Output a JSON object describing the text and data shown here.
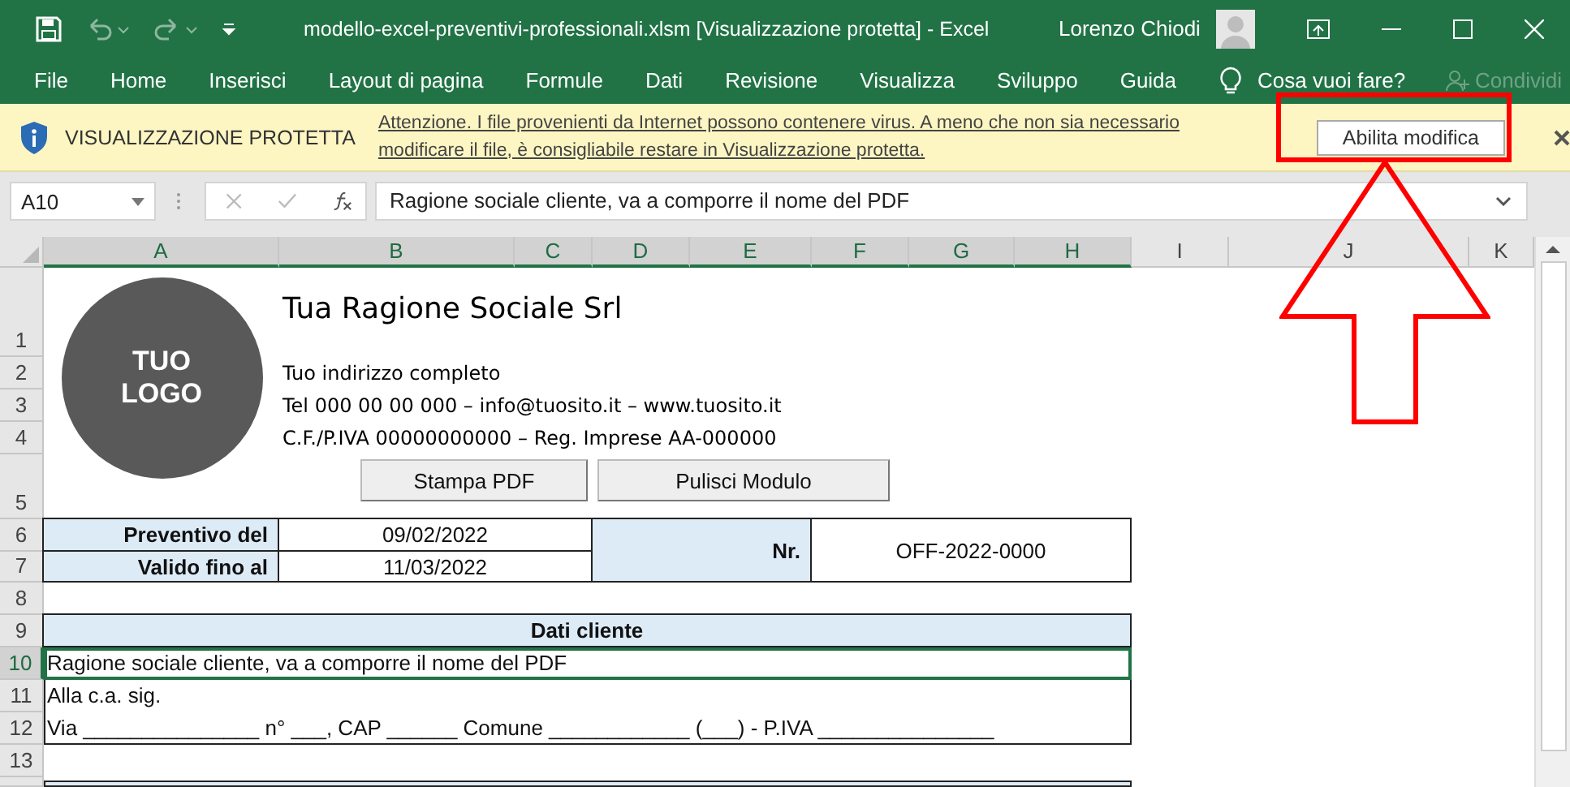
{
  "window": {
    "title": "modello-excel-preventivi-professionali.xlsm  [Visualizzazione protetta]  -  Excel",
    "user": "Lorenzo Chiodi"
  },
  "ribbon_tabs": [
    {
      "label": "File"
    },
    {
      "label": "Home"
    },
    {
      "label": "Inserisci"
    },
    {
      "label": "Layout di pagina"
    },
    {
      "label": "Formule"
    },
    {
      "label": "Dati"
    },
    {
      "label": "Revisione"
    },
    {
      "label": "Visualizza"
    },
    {
      "label": "Sviluppo"
    },
    {
      "label": "Guida"
    }
  ],
  "tell_me": "Cosa vuoi fare?",
  "share": {
    "label": "Condividi",
    "disabled": true
  },
  "protected_view": {
    "label": "VISUALIZZAZIONE PROTETTA",
    "message": "Attenzione. I file provenienti da Internet possono contenere virus. A meno che non sia necessario modificare il file, è consigliabile restare in Visualizzazione protetta.",
    "button": "Abilita modifica"
  },
  "formula_bar": {
    "name_box": "A10",
    "formula": "Ragione sociale cliente, va a comporre il nome del PDF"
  },
  "columns": [
    {
      "label": "A",
      "selected": true
    },
    {
      "label": "B",
      "selected": true
    },
    {
      "label": "C",
      "selected": true
    },
    {
      "label": "D",
      "selected": true
    },
    {
      "label": "E",
      "selected": true
    },
    {
      "label": "F",
      "selected": true
    },
    {
      "label": "G",
      "selected": true
    },
    {
      "label": "H",
      "selected": true
    },
    {
      "label": "I",
      "selected": false
    },
    {
      "label": "J",
      "selected": false
    },
    {
      "label": "K",
      "selected": false
    }
  ],
  "rows": [
    {
      "label": "1",
      "selected": false
    },
    {
      "label": "2",
      "selected": false
    },
    {
      "label": "3",
      "selected": false
    },
    {
      "label": "4",
      "selected": false
    },
    {
      "label": "5",
      "selected": false
    },
    {
      "label": "6",
      "selected": false
    },
    {
      "label": "7",
      "selected": false
    },
    {
      "label": "8",
      "selected": false
    },
    {
      "label": "9",
      "selected": false
    },
    {
      "label": "10",
      "selected": true
    },
    {
      "label": "11",
      "selected": false
    },
    {
      "label": "12",
      "selected": false
    },
    {
      "label": "13",
      "selected": false
    }
  ],
  "sheet": {
    "logo": [
      "TUO",
      "LOGO"
    ],
    "company": "Tua Ragione Sociale Srl",
    "address_lines": [
      "Tuo indirizzo completo",
      "Tel 000 00 00 000 – info@tuosito.it – www.tuosito.it",
      "C.F./P.IVA 00000000000 – Reg. Imprese AA-000000"
    ],
    "buttons": [
      "Stampa PDF",
      "Pulisci Modulo"
    ],
    "quote_date_label": "Preventivo del",
    "quote_date": "09/02/2022",
    "valid_label": "Valido fino al",
    "valid_date": "11/03/2022",
    "number_label": "Nr.",
    "number": "OFF-2022-0000",
    "client_heading": "Dati cliente",
    "client_lines": [
      "Ragione sociale cliente, va a comporre il nome del PDF",
      "Alla c.a. sig.",
      "Via _______________ n° ___, CAP ______ Comune ____________ (___) - P.IVA _______________"
    ]
  }
}
